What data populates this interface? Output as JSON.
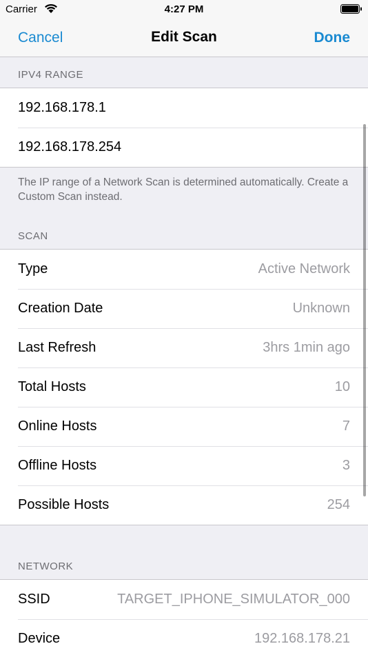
{
  "status_bar": {
    "carrier": "Carrier",
    "time": "4:27 PM"
  },
  "nav": {
    "cancel_label": "Cancel",
    "title": "Edit Scan",
    "done_label": "Done"
  },
  "ipv4": {
    "header": "IPV4 RANGE",
    "start": "192.168.178.1",
    "end": "192.168.178.254",
    "footer": "The IP range of a Network Scan is determined automatically. Create a Custom Scan instead."
  },
  "scan": {
    "header": "SCAN",
    "rows": [
      {
        "label": "Type",
        "value": "Active Network"
      },
      {
        "label": "Creation Date",
        "value": "Unknown"
      },
      {
        "label": "Last Refresh",
        "value": "3hrs 1min ago"
      },
      {
        "label": "Total Hosts",
        "value": "10"
      },
      {
        "label": "Online Hosts",
        "value": "7"
      },
      {
        "label": "Offline Hosts",
        "value": "3"
      },
      {
        "label": "Possible Hosts",
        "value": "254"
      }
    ]
  },
  "network": {
    "header": "NETWORK",
    "rows": [
      {
        "label": "SSID",
        "value": "TARGET_IPHONE_SIMULATOR_000"
      },
      {
        "label": "Device",
        "value": "192.168.178.21"
      }
    ]
  },
  "colors": {
    "accent": "#1a8ad1",
    "background": "#efeff4",
    "secondary_text": "#9c9ca1"
  },
  "icons": [
    "wifi-icon",
    "battery-icon"
  ]
}
